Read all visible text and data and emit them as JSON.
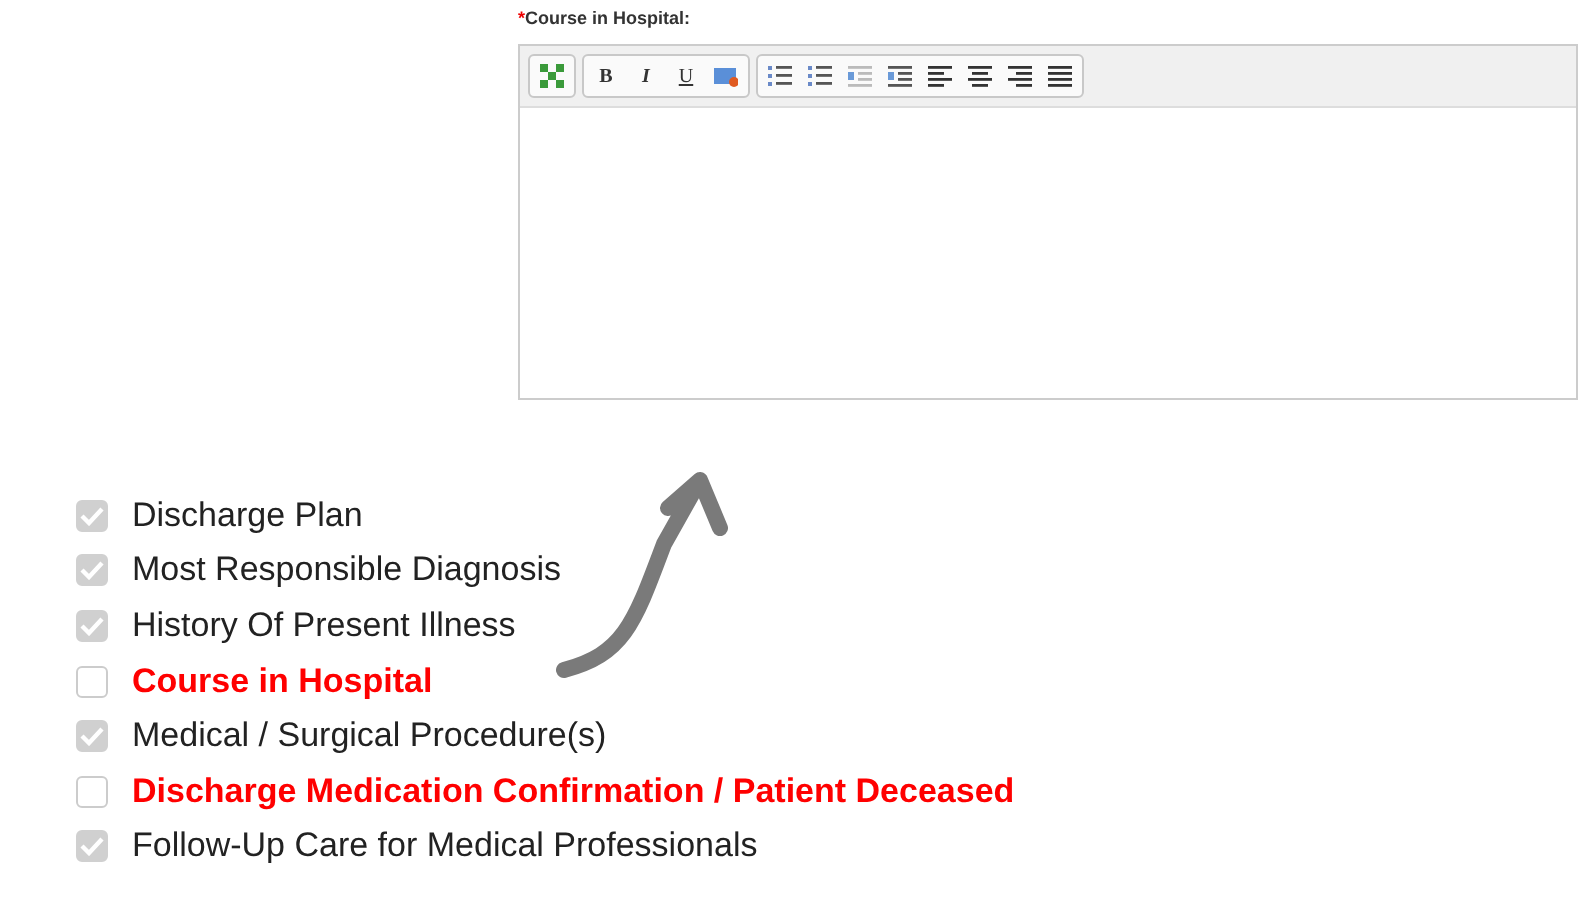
{
  "editor": {
    "label": "Course in Hospital:",
    "required_mark": "*",
    "toolbar_groups": [
      [
        {
          "kind": "fullscreen"
        }
      ],
      [
        {
          "kind": "text",
          "text": "B"
        },
        {
          "kind": "text",
          "text": "I"
        },
        {
          "kind": "text",
          "text": "U"
        },
        {
          "kind": "image"
        }
      ],
      [
        {
          "kind": "numbered"
        },
        {
          "kind": "bullets"
        },
        {
          "kind": "outdent"
        },
        {
          "kind": "indent"
        },
        {
          "kind": "left"
        },
        {
          "kind": "center"
        },
        {
          "kind": "right"
        },
        {
          "kind": "justify"
        }
      ]
    ]
  },
  "checklist": [
    {
      "label": "Discharge Plan",
      "checked": true
    },
    {
      "label": "Most Responsible Diagnosis",
      "checked": true
    },
    {
      "label": "History Of Present Illness",
      "checked": true
    },
    {
      "label": "Course in Hospital",
      "checked": false
    },
    {
      "label": "Medical / Surgical Procedure(s)",
      "checked": true
    },
    {
      "label": "Discharge Medication Confirmation / Patient Deceased",
      "checked": false
    },
    {
      "label": "Follow-Up Care for Medical Professionals",
      "checked": true
    }
  ]
}
